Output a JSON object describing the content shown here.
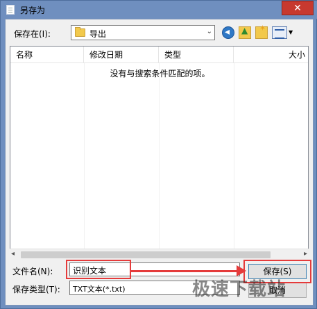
{
  "window": {
    "title": "另存为",
    "close_glyph": "✕"
  },
  "toolbar": {
    "save_in_label": "保存在(I):",
    "location": "导出",
    "icons": [
      "back-icon",
      "up-folder-icon",
      "new-folder-icon",
      "view-menu-icon"
    ]
  },
  "filelist": {
    "columns": [
      "名称",
      "修改日期",
      "类型",
      "大小"
    ],
    "empty_message": "没有与搜索条件匹配的项。"
  },
  "form": {
    "filename_label": "文件名(N):",
    "filename_value": "识别文本",
    "filetype_label": "保存类型(T):",
    "filetype_value": "TXT文本(*.txt)"
  },
  "buttons": {
    "save": "保存(S)",
    "cancel": "取消"
  },
  "watermark": "极速下载站",
  "colors": {
    "annotation": "#e53b3b",
    "titlebar": "#6f8fbf",
    "close": "#c7392f"
  }
}
